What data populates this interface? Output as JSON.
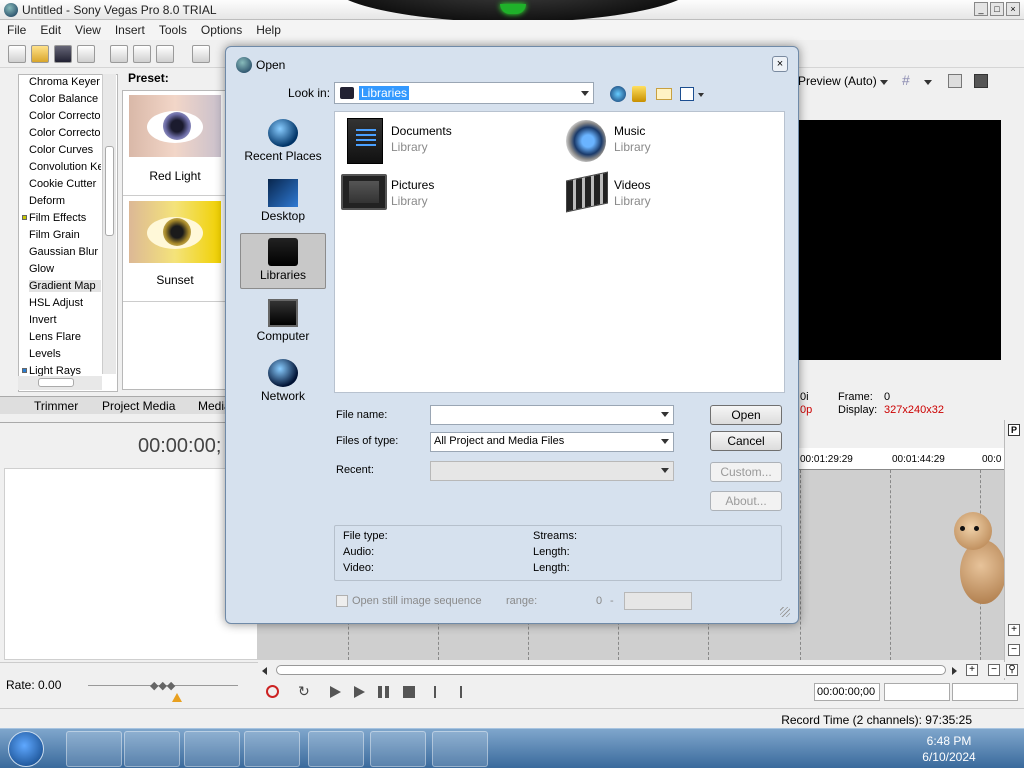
{
  "window": {
    "title": "Untitled - Sony Vegas Pro 8.0 TRIAL",
    "controls": {
      "minimize": "_",
      "maximize": "□",
      "close": "×"
    }
  },
  "menu": [
    "File",
    "Edit",
    "View",
    "Insert",
    "Tools",
    "Options",
    "Help"
  ],
  "fx_list": [
    "Chroma Keyer",
    "Color Balance",
    "Color Corrector",
    "Color Corrector",
    "Color Curves",
    "Convolution Kernel",
    "Cookie Cutter",
    "Deform",
    "Film Effects",
    "Film Grain",
    "Gaussian Blur",
    "Glow",
    "Gradient Map",
    "HSL Adjust",
    "Invert",
    "Lens Flare",
    "Levels",
    "Light Rays"
  ],
  "preset": {
    "label": "Preset:",
    "items": [
      "Red Light",
      "Sunset"
    ]
  },
  "bottom_tabs": [
    "Trimmer",
    "Project Media",
    "Media"
  ],
  "timecode": "00:00:00;",
  "rate": "Rate: 0.00",
  "preview": {
    "quality": "Preview (Auto)",
    "info_left_1": "0i",
    "info_left_2": "0p",
    "frame_label": "Frame:",
    "frame_value": "0",
    "display_label": "Display:",
    "display_value": "327x240x32"
  },
  "ruler_marks": [
    "00:01:29:29",
    "00:01:44:29",
    "00:0"
  ],
  "transport_time": "00:00:00;00",
  "status": "Record Time (2 channels): 97:35:25",
  "clock": {
    "time": "6:48 PM",
    "date": "6/10/2024"
  },
  "dialog": {
    "title": "Open",
    "close": "×",
    "look_in_label": "Look in:",
    "look_in_value": "Libraries",
    "places": [
      "Recent Places",
      "Desktop",
      "Libraries",
      "Computer",
      "Network"
    ],
    "files": [
      {
        "name": "Documents",
        "sub": "Library"
      },
      {
        "name": "Music",
        "sub": "Library"
      },
      {
        "name": "Pictures",
        "sub": "Library"
      },
      {
        "name": "Videos",
        "sub": "Library"
      }
    ],
    "file_name_label": "File name:",
    "file_name_value": "",
    "files_of_type_label": "Files of type:",
    "files_of_type_value": "All Project and Media Files",
    "recent_label": "Recent:",
    "recent_value": "",
    "buttons": {
      "open": "Open",
      "cancel": "Cancel",
      "custom": "Custom...",
      "about": "About..."
    },
    "info": {
      "file_type": "File type:",
      "audio": "Audio:",
      "video": "Video:",
      "streams": "Streams:",
      "length1": "Length:",
      "length2": "Length:"
    },
    "sequence_label": "Open still image sequence",
    "range_label": "range:",
    "range_value": "0",
    "range_dash": "-"
  }
}
